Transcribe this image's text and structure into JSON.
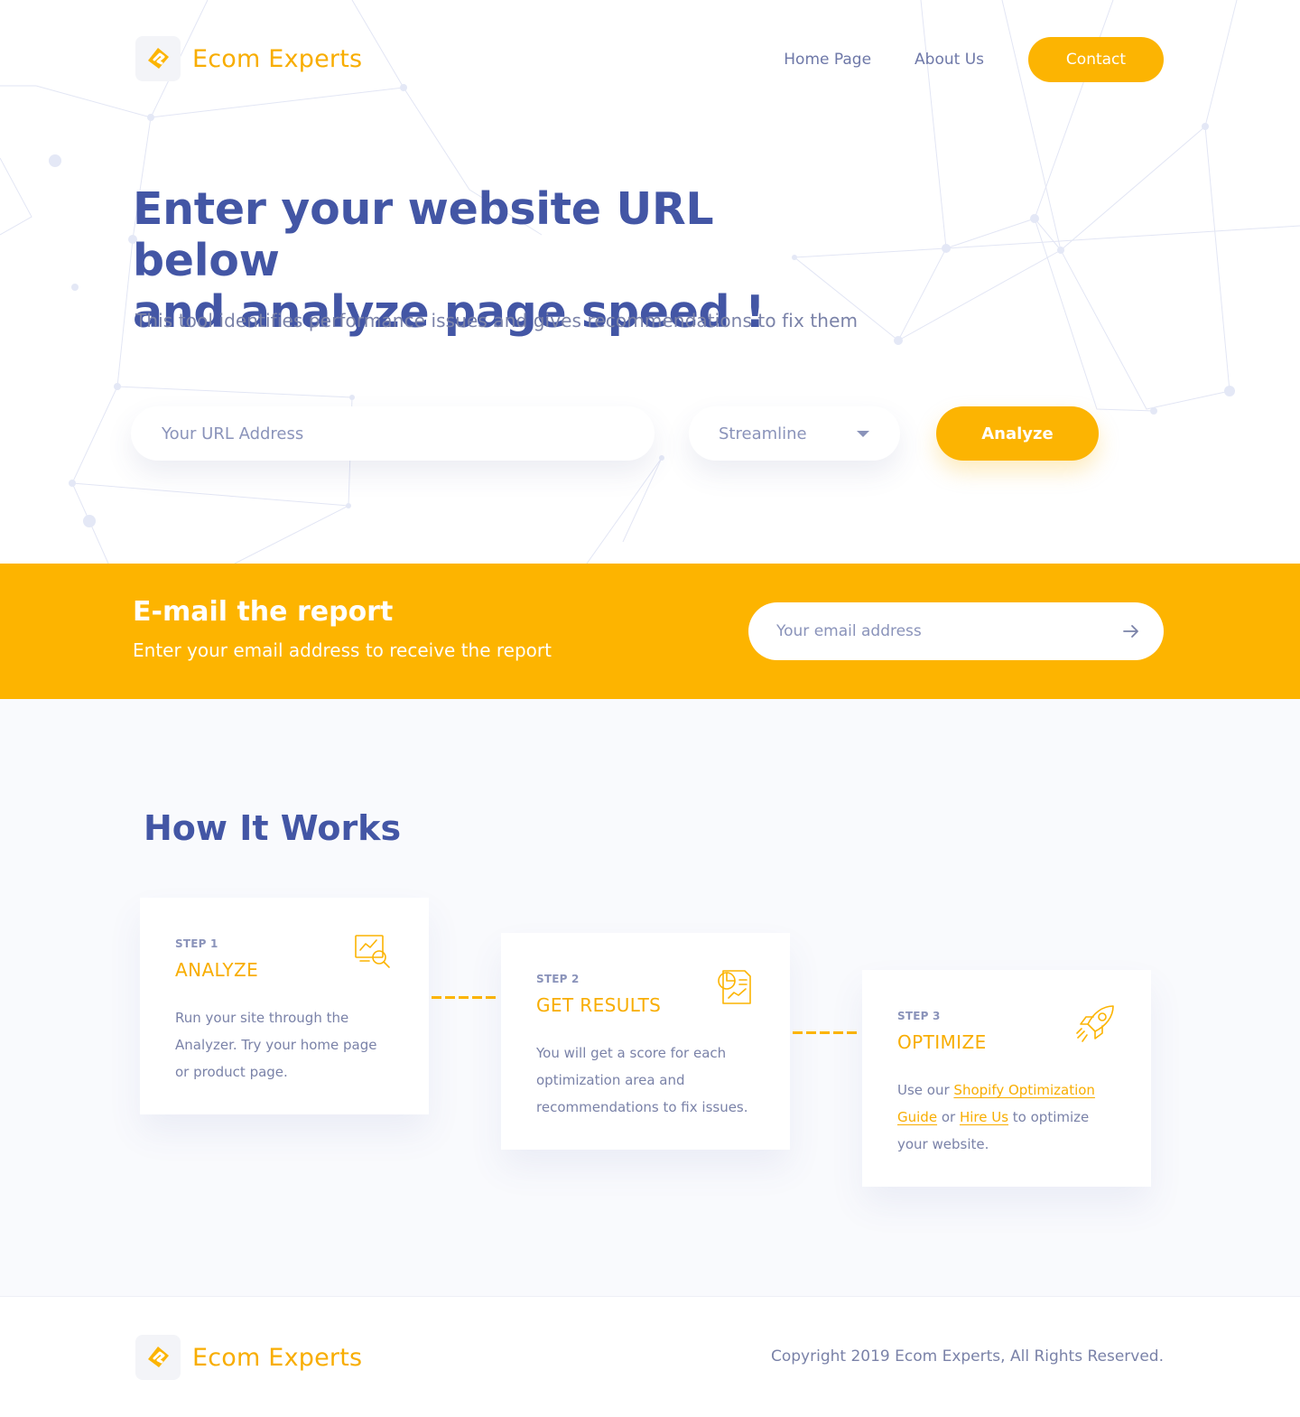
{
  "header": {
    "brand_name": "Ecom Experts",
    "nav": {
      "home": "Home Page",
      "about": "About Us",
      "contact": "Contact"
    }
  },
  "hero": {
    "title_line1": "Enter your website URL below",
    "title_line2": "and analyze page speed !",
    "subtitle": "This tool identifies performance issues and gives recommendations to fix them",
    "url_placeholder": "Your URL Address",
    "select_value": "Streamline",
    "analyze_label": "Analyze"
  },
  "email_report": {
    "title": "E-mail the report",
    "subtitle": "Enter your email address to receive the report",
    "email_placeholder": "Your email address"
  },
  "how_it_works": {
    "title": "How It Works",
    "steps": [
      {
        "step": "STEP 1",
        "title": "ANALYZE",
        "icon": "analytics-search-icon",
        "text_line1": "Run your site through the",
        "text_line2": "Analyzer. Try your home page",
        "text_line3": "or product page."
      },
      {
        "step": "STEP 2",
        "title": "GET RESULTS",
        "icon": "report-chart-icon",
        "text_line1": "You will get a score for each",
        "text_line2": "optimization area and",
        "text_line3": "recommendations to fix issues."
      },
      {
        "step": "STEP 3",
        "title": "OPTIMIZE",
        "icon": "rocket-icon",
        "text_pre": "Use our ",
        "link1": "Shopify Optimization",
        "link1b": "Guide",
        "text_or": " or ",
        "link2": "Hire Us",
        "text_post": " to optimize",
        "text_line3": "your website."
      }
    ]
  },
  "footer": {
    "brand_name": "Ecom Experts",
    "copyright": "Copyright 2019 Ecom Experts, All Rights Reserved."
  },
  "colors": {
    "accent": "#fcb402",
    "heading": "#4356a5",
    "muted_text": "#7a82a8",
    "section_bg": "#f9fafd"
  }
}
